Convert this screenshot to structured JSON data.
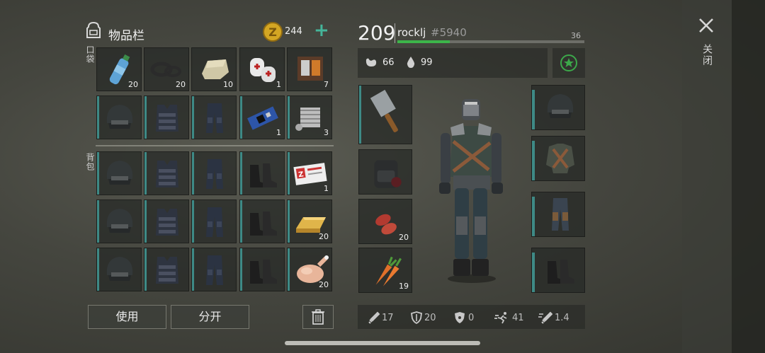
{
  "inventory": {
    "title": "物品栏",
    "coins": "244",
    "pocket_label": "口袋",
    "backpack_label": "背包",
    "pocket_rows": [
      [
        {
          "icon": "water-bottle",
          "count": "20"
        },
        {
          "icon": "duct-tape",
          "count": "20"
        },
        {
          "icon": "stone",
          "count": "10"
        },
        {
          "icon": "bandage",
          "count": "1"
        },
        {
          "icon": "wallet",
          "count": "7"
        }
      ],
      [
        {
          "icon": "helmet",
          "count": ""
        },
        {
          "icon": "tactical-vest",
          "count": ""
        },
        {
          "icon": "tactical-pants",
          "count": ""
        },
        {
          "icon": "circuit-board",
          "count": "1"
        },
        {
          "icon": "engine-part",
          "count": "3"
        }
      ]
    ],
    "backpack_rows": [
      [
        {
          "icon": "helmet",
          "count": ""
        },
        {
          "icon": "tactical-vest",
          "count": ""
        },
        {
          "icon": "tactical-pants",
          "count": ""
        },
        {
          "icon": "boots",
          "count": ""
        },
        {
          "icon": "id-card",
          "count": "1"
        }
      ],
      [
        {
          "icon": "helmet",
          "count": ""
        },
        {
          "icon": "tactical-vest",
          "count": ""
        },
        {
          "icon": "tactical-pants",
          "count": ""
        },
        {
          "icon": "boots",
          "count": ""
        },
        {
          "icon": "gold-bar",
          "count": "20"
        }
      ],
      [
        {
          "icon": "helmet",
          "count": ""
        },
        {
          "icon": "tactical-vest",
          "count": ""
        },
        {
          "icon": "tactical-pants",
          "count": ""
        },
        {
          "icon": "boots",
          "count": ""
        },
        {
          "icon": "roast-chicken",
          "count": "20"
        }
      ]
    ],
    "use_label": "使用",
    "split_label": "分开"
  },
  "player": {
    "level": "209",
    "name": "rocklj",
    "tag": "#5940",
    "xp_value": "36",
    "xp_fill": 0.28,
    "hunger": "66",
    "thirst": "99"
  },
  "quick_slots": [
    {
      "icon": "cleaver",
      "count": ""
    },
    {
      "icon": "backpack",
      "count": ""
    },
    {
      "icon": "raw-meat",
      "count": "20"
    },
    {
      "icon": "carrot",
      "count": "19"
    }
  ],
  "equipment": [
    {
      "icon": "helmet"
    },
    {
      "icon": "jacket"
    },
    {
      "icon": "pants"
    },
    {
      "icon": "boots"
    }
  ],
  "stats": {
    "attack": "17",
    "defense": "20",
    "radiation": "0",
    "speed": "41",
    "attack_speed": "1.4"
  },
  "close_label": "关闭",
  "colors": {
    "accent": "#3aa88a",
    "slot_bar": "#3e8a86",
    "xp": "#3cb54a"
  }
}
